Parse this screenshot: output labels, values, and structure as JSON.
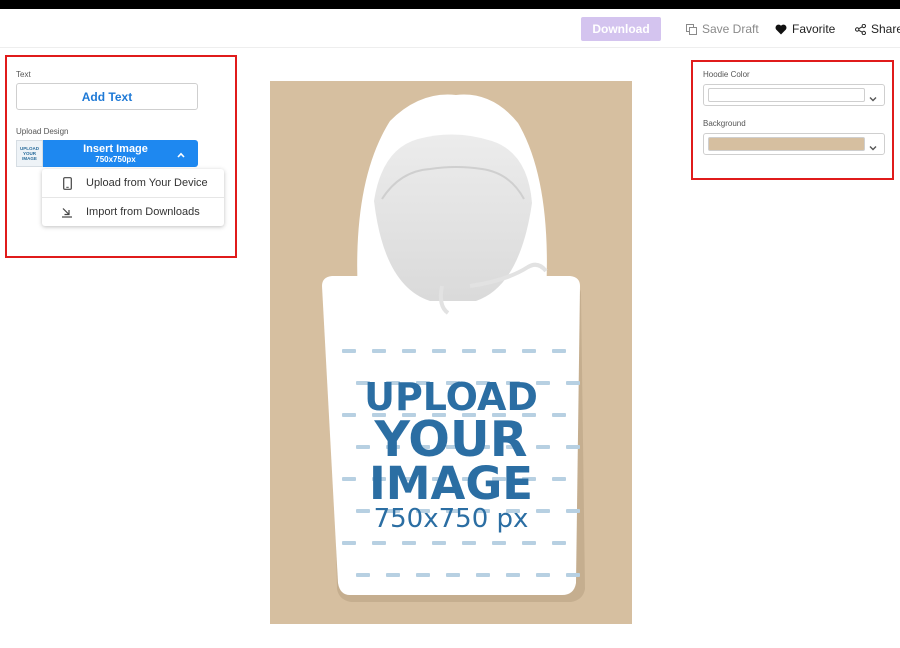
{
  "header": {
    "download_label": "Download",
    "save_draft_label": "Save Draft",
    "favorite_label": "Favorite",
    "share_label": "Share"
  },
  "left_panel": {
    "text_label": "Text",
    "add_text_label": "Add Text",
    "upload_design_label": "Upload Design",
    "thumb_lines": [
      "UPLOAD",
      "YOUR",
      "IMAGE"
    ],
    "insert_image_label": "Insert Image",
    "insert_image_size": "750x750px",
    "dropdown": [
      {
        "label": "Upload from Your Device",
        "icon": "phone-icon"
      },
      {
        "label": "Import from Downloads",
        "icon": "download-arrow-icon"
      }
    ]
  },
  "right_panel": {
    "hoodie_color_label": "Hoodie Color",
    "hoodie_color_value": "#ffffff",
    "background_label": "Background",
    "background_value": "#d6bfa0"
  },
  "canvas": {
    "placeholder_lines": [
      "UPLOAD",
      "YOUR",
      "IMAGE",
      "750x750 px"
    ],
    "background": "#d6bfa0",
    "hoodie_color": "#ffffff",
    "text_color": "#2b6ea3"
  },
  "colors": {
    "accent": "#1e88f0",
    "download_disabled": "#d4c4ef",
    "highlight_border": "#e01b1b"
  }
}
